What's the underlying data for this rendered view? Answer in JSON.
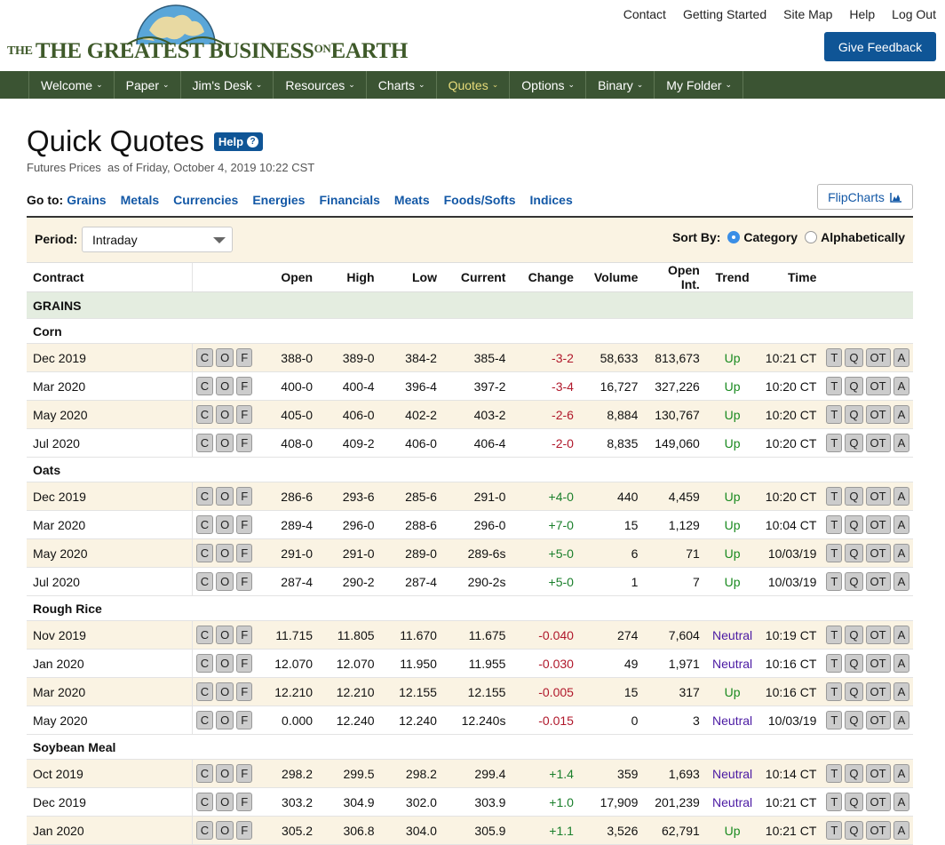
{
  "logo": {
    "text_main": "THE GREATEST BUSINESS",
    "text_on": "ON",
    "text_end": "EARTH"
  },
  "top_links": [
    "Contact",
    "Getting Started",
    "Site Map",
    "Help",
    "Log Out"
  ],
  "feedback_label": "Give Feedback",
  "nav": [
    {
      "label": "Welcome",
      "active": false
    },
    {
      "label": "Paper",
      "active": false
    },
    {
      "label": "Jim's Desk",
      "active": false
    },
    {
      "label": "Resources",
      "active": false
    },
    {
      "label": "Charts",
      "active": false
    },
    {
      "label": "Quotes",
      "active": true
    },
    {
      "label": "Options",
      "active": false
    },
    {
      "label": "Binary",
      "active": false
    },
    {
      "label": "My Folder",
      "active": false
    }
  ],
  "page": {
    "title": "Quick Quotes",
    "help": "Help",
    "subtitle_prefix": "Futures Prices",
    "subtitle": "as of Friday, October 4, 2019 10:22 CST"
  },
  "goto": {
    "label": "Go to:",
    "links": [
      "Grains",
      "Metals",
      "Currencies",
      "Energies",
      "Financials",
      "Meats",
      "Foods/Softs",
      "Indices"
    ]
  },
  "flipcharts": "FlipCharts",
  "filter": {
    "period_label": "Period:",
    "period_value": "Intraday",
    "sort_label": "Sort By:",
    "sort_options": [
      "Category",
      "Alphabetically"
    ],
    "sort_selected": "Category"
  },
  "table": {
    "headers": [
      "Contract",
      "",
      "Open",
      "High",
      "Low",
      "Current",
      "Change",
      "Volume",
      "Open Int.",
      "Trend",
      "Time",
      ""
    ],
    "row_buttons": [
      "C",
      "O",
      "F"
    ],
    "action_buttons": [
      "T",
      "Q",
      "OT",
      "A"
    ],
    "category": "GRAINS",
    "groups": [
      {
        "name": "Corn",
        "rows": [
          [
            "Dec 2019",
            "388-0",
            "389-0",
            "384-2",
            "385-4",
            "-3-2",
            "58,633",
            "813,673",
            "Up",
            "10:21 CT"
          ],
          [
            "Mar 2020",
            "400-0",
            "400-4",
            "396-4",
            "397-2",
            "-3-4",
            "16,727",
            "327,226",
            "Up",
            "10:20 CT"
          ],
          [
            "May 2020",
            "405-0",
            "406-0",
            "402-2",
            "403-2",
            "-2-6",
            "8,884",
            "130,767",
            "Up",
            "10:20 CT"
          ],
          [
            "Jul 2020",
            "408-0",
            "409-2",
            "406-0",
            "406-4",
            "-2-0",
            "8,835",
            "149,060",
            "Up",
            "10:20 CT"
          ]
        ]
      },
      {
        "name": "Oats",
        "rows": [
          [
            "Dec 2019",
            "286-6",
            "293-6",
            "285-6",
            "291-0",
            "+4-0",
            "440",
            "4,459",
            "Up",
            "10:20 CT"
          ],
          [
            "Mar 2020",
            "289-4",
            "296-0",
            "288-6",
            "296-0",
            "+7-0",
            "15",
            "1,129",
            "Up",
            "10:04 CT"
          ],
          [
            "May 2020",
            "291-0",
            "291-0",
            "289-0",
            "289-6s",
            "+5-0",
            "6",
            "71",
            "Up",
            "10/03/19"
          ],
          [
            "Jul 2020",
            "287-4",
            "290-2",
            "287-4",
            "290-2s",
            "+5-0",
            "1",
            "7",
            "Up",
            "10/03/19"
          ]
        ]
      },
      {
        "name": "Rough Rice",
        "rows": [
          [
            "Nov 2019",
            "11.715",
            "11.805",
            "11.670",
            "11.675",
            "-0.040",
            "274",
            "7,604",
            "Neutral",
            "10:19 CT"
          ],
          [
            "Jan 2020",
            "12.070",
            "12.070",
            "11.950",
            "11.955",
            "-0.030",
            "49",
            "1,971",
            "Neutral",
            "10:16 CT"
          ],
          [
            "Mar 2020",
            "12.210",
            "12.210",
            "12.155",
            "12.155",
            "-0.005",
            "15",
            "317",
            "Up",
            "10:16 CT"
          ],
          [
            "May 2020",
            "0.000",
            "12.240",
            "12.240",
            "12.240s",
            "-0.015",
            "0",
            "3",
            "Neutral",
            "10/03/19"
          ]
        ]
      },
      {
        "name": "Soybean Meal",
        "rows": [
          [
            "Oct 2019",
            "298.2",
            "299.5",
            "298.2",
            "299.4",
            "+1.4",
            "359",
            "1,693",
            "Neutral",
            "10:14 CT"
          ],
          [
            "Dec 2019",
            "303.2",
            "304.9",
            "302.0",
            "303.9",
            "+1.0",
            "17,909",
            "201,239",
            "Neutral",
            "10:21 CT"
          ],
          [
            "Jan 2020",
            "305.2",
            "306.8",
            "304.0",
            "305.9",
            "+1.1",
            "3,526",
            "62,791",
            "Up",
            "10:21 CT"
          ]
        ]
      }
    ]
  },
  "colors": {
    "nav_bg": "#3b5433",
    "brand_blue": "#0f5596",
    "link": "#1358a6",
    "negative": "#b0182b",
    "positive": "#1a7f2b",
    "neutral": "#4b1aa3",
    "row_alt": "#faf3e3",
    "category_bg": "#e4ede0"
  }
}
